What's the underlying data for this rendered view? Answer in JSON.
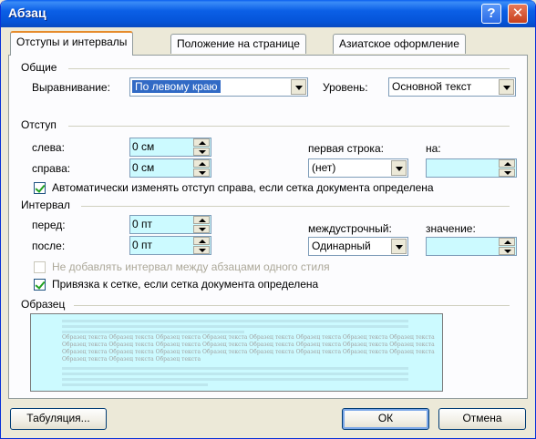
{
  "window": {
    "title": "Абзац",
    "help_label": "?",
    "close_label": "✕"
  },
  "tabs": [
    {
      "label": "Отступы и интервалы",
      "active": true
    },
    {
      "label": "Положение на странице",
      "active": false
    },
    {
      "label": "Азиатское оформление",
      "active": false
    }
  ],
  "general": {
    "heading": "Общие",
    "alignment_label": "Выравнивание:",
    "alignment_value": "По левому краю",
    "level_label": "Уровень:",
    "level_value": "Основной текст"
  },
  "indent": {
    "heading": "Отступ",
    "left_label": "слева:",
    "left_value": "0 см",
    "right_label": "справа:",
    "right_value": "0 см",
    "first_line_label": "первая строка:",
    "first_line_value": "(нет)",
    "by_label": "на:",
    "by_value": "",
    "auto_adjust_label": "Автоматически изменять отступ справа, если сетка документа определена",
    "auto_adjust_checked": true
  },
  "spacing": {
    "heading": "Интервал",
    "before_label": "перед:",
    "before_value": "0 пт",
    "after_label": "после:",
    "after_value": "0 пт",
    "line_spacing_label": "междустрочный:",
    "line_spacing_value": "Одинарный",
    "at_label": "значение:",
    "at_value": "",
    "no_space_label": "Не добавлять интервал между абзацами одного стиля",
    "no_space_checked": false,
    "snap_grid_label": "Привязка к сетке, если сетка документа определена",
    "snap_grid_checked": true
  },
  "preview": {
    "heading": "Образец",
    "sample_lines": [
      "Образец текста Образец текста Образец текста Образец текста Образец текста Образец текста Образец текста Образец текста",
      "Образец текста Образец текста Образец текста Образец текста Образец текста Образец текста Образец текста Образец текста",
      "Образец текста Образец текста Образец текста Образец текста Образец текста Образец текста Образец текста Образец текста",
      "Образец текста Образец текста Образец текста"
    ]
  },
  "buttons": {
    "tabs_label": "Табуляция...",
    "ok_label": "ОК",
    "cancel_label": "Отмена"
  },
  "colors": {
    "titlebar": "#0554d8",
    "field_bg": "#ccfaff",
    "dialog_bg": "#ece9d8",
    "tab_accent": "#e68b2c"
  }
}
